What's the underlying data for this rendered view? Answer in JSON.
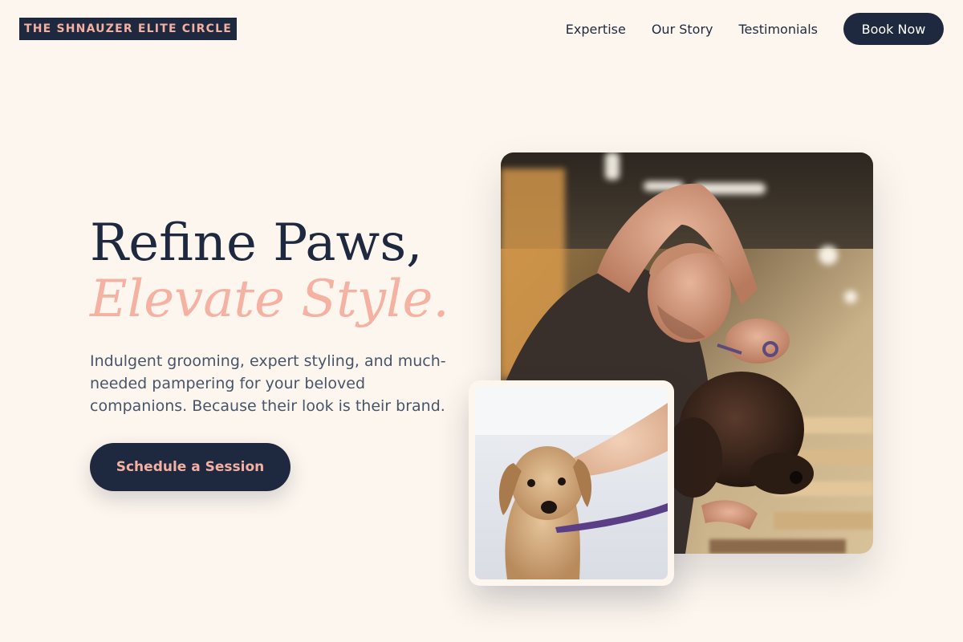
{
  "brand": {
    "logo_text": "THE SHNAUZER ELITE CIRCLE"
  },
  "nav": {
    "links": [
      "Expertise",
      "Our Story",
      "Testimonials"
    ],
    "cta_label": "Book Now"
  },
  "hero": {
    "headline_line1": "Refine Paws,",
    "headline_line2": "Elevate Style.",
    "subtext": "Indulgent grooming, expert styling, and much-needed pampering for your beloved companions. Because their look is their brand.",
    "cta_label": "Schedule a Session"
  },
  "images": {
    "main_alt": "Groomer trimming a dark poodle with scissors",
    "inset_alt": "Wet terrier on a purple leash after a bath"
  },
  "colors": {
    "background": "#fdf6ee",
    "navy": "#1e2940",
    "accent_peach": "#f5b1a2",
    "body_text": "#475569"
  }
}
